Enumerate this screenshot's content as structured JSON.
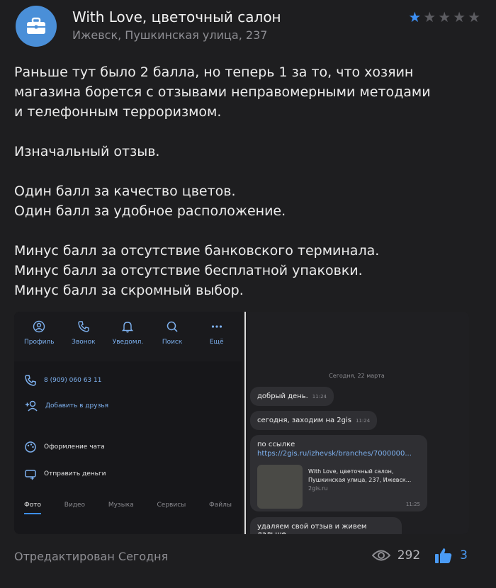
{
  "header": {
    "org_name": "With Love, цветочный салон",
    "address": "Ижевск, Пушкинская улица, 237",
    "rating": 1,
    "rating_max": 5,
    "accent_color": "#3d8ff2"
  },
  "review": {
    "paragraphs": [
      [
        "Раньше тут было 2 балла, но теперь 1 за то, что хозяин",
        "магазина борется с отзывами неправомерными методами",
        "и телефонным терроризмом."
      ],
      [
        "Изначальный отзыв."
      ],
      [
        "Один балл за качество цветов.",
        "Один балл за удобное расположение."
      ],
      [
        "Минус балл за отсутствие банковского терминала.",
        "Минус балл за отсутствие бесплатной упаковки.",
        "Минус балл за скромный выбор."
      ]
    ]
  },
  "left_screenshot": {
    "top_buttons": [
      {
        "label": "Профиль",
        "icon": "profile-icon"
      },
      {
        "label": "Звонок",
        "icon": "phone-icon"
      },
      {
        "label": "Уведомл.",
        "icon": "bell-icon"
      },
      {
        "label": "Поиск",
        "icon": "search-icon"
      },
      {
        "label": "Ещё",
        "icon": "more-icon"
      }
    ],
    "phone": "8 (909) 060 63 11",
    "add_friend": "Добавить в друзья",
    "chat_design": "Оформление чата",
    "send_money": "Отправить деньги",
    "tabs": [
      "Фото",
      "Видео",
      "Музыка",
      "Сервисы",
      "Файлы"
    ]
  },
  "right_screenshot": {
    "date": "Сегодня, 22 марта",
    "messages": [
      {
        "text": "добрый день.",
        "time": "11:24"
      },
      {
        "text": "сегодня, заходим на 2gis",
        "time": "11:24"
      }
    ],
    "link_message": {
      "text": "по ссылке",
      "url": "https://2gis.ru/izhevsk/branches/7000000...",
      "preview_title": "With Love, цветочный салон,",
      "preview_line2": "Пушкинская улица, 237, Ижевск...",
      "preview_source": "2gis.ru",
      "time": "11:25"
    },
    "last_message": "удаляем свой отзыв и живем дальше"
  },
  "footer": {
    "edited": "Отредактирован Сегодня",
    "views": "292",
    "likes": "3"
  }
}
